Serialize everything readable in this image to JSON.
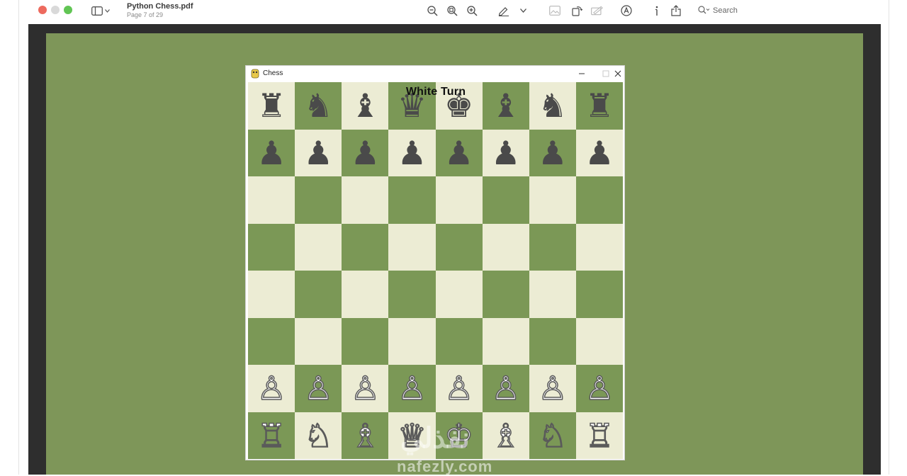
{
  "app": {
    "document_title": "Python Chess.pdf",
    "page_indicator": "Page 7 of 29",
    "search_label": "Search"
  },
  "toolbar_icons": [
    "sidebar-toggle-icon",
    "zoom-out-icon",
    "zoom-actual-icon",
    "zoom-in-icon",
    "markup-pen-icon",
    "chevron-down-icon",
    "image-icon",
    "rotate-icon",
    "redact-icon",
    "annotate-icon",
    "info-icon",
    "share-icon",
    "search-icon"
  ],
  "game_window": {
    "title": "Chess",
    "turn_label": "White Turn"
  },
  "board": {
    "rows": [
      [
        "♜",
        "♞",
        "♝",
        "♛",
        "♚",
        "♝",
        "♞",
        "♜"
      ],
      [
        "♟",
        "♟",
        "♟",
        "♟",
        "♟",
        "♟",
        "♟",
        "♟"
      ],
      [
        "",
        "",
        "",
        "",
        "",
        "",
        "",
        ""
      ],
      [
        "",
        "",
        "",
        "",
        "",
        "",
        "",
        ""
      ],
      [
        "",
        "",
        "",
        "",
        "",
        "",
        "",
        ""
      ],
      [
        "",
        "",
        "",
        "",
        "",
        "",
        "",
        ""
      ],
      [
        "♙",
        "♙",
        "♙",
        "♙",
        "♙",
        "♙",
        "♙",
        "♙"
      ],
      [
        "♖",
        "♘",
        "♗",
        "♕",
        "♔",
        "♗",
        "♘",
        "♖"
      ]
    ],
    "colors": {
      "light": "#ececd4",
      "dark": "#7b9856"
    }
  },
  "watermark": {
    "latin": "nafezly.com",
    "arabic": "نفذلي"
  }
}
